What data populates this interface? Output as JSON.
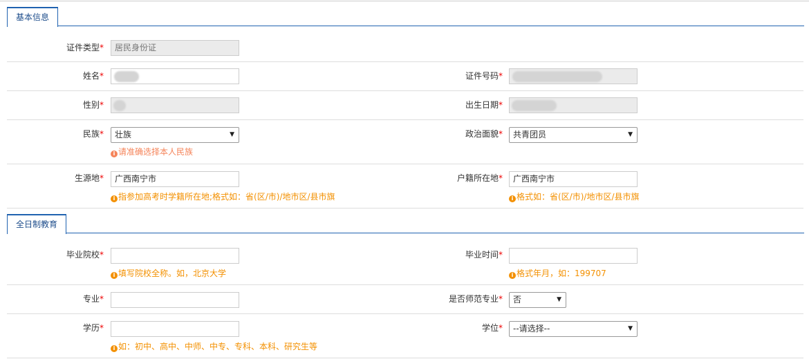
{
  "sections": [
    {
      "title": "基本信息"
    },
    {
      "title": "全日制教育"
    }
  ],
  "required_mark": "*",
  "fields": {
    "id_type": {
      "label": "证件类型",
      "value": "居民身份证"
    },
    "name": {
      "label": "姓名"
    },
    "id_number": {
      "label": "证件号码"
    },
    "gender": {
      "label": "性别"
    },
    "birth_date": {
      "label": "出生日期"
    },
    "ethnicity": {
      "label": "民族",
      "value": "壮族",
      "hint": "请准确选择本人民族"
    },
    "political": {
      "label": "政治面貌",
      "value": "共青团员"
    },
    "origin": {
      "label": "生源地",
      "value": "广西南宁市",
      "hint": "指参加高考时学籍所在地;格式如：省(区/市)/地市区/县市旗"
    },
    "household": {
      "label": "户籍所在地",
      "value": "广西南宁市",
      "hint": "格式如：省(区/市)/地市区/县市旗"
    },
    "school": {
      "label": "毕业院校",
      "value": "",
      "hint": "填写院校全称。如，北京大学"
    },
    "grad_time": {
      "label": "毕业时间",
      "value": "",
      "hint": "格式年月，如：199707"
    },
    "major": {
      "label": "专业",
      "value": ""
    },
    "normal_major": {
      "label": "是否师范专业",
      "value": "否"
    },
    "education": {
      "label": "学历",
      "value": "",
      "hint": "如：初中、高中、中师、中专、专科、本科、研究生等"
    },
    "degree": {
      "label": "学位",
      "value": "--请选择--"
    }
  },
  "icons": {
    "info": "i",
    "dropdown": "▼"
  },
  "colors": {
    "accent": "#1f62b0",
    "hint": "#f39000",
    "required": "#ee0000"
  }
}
